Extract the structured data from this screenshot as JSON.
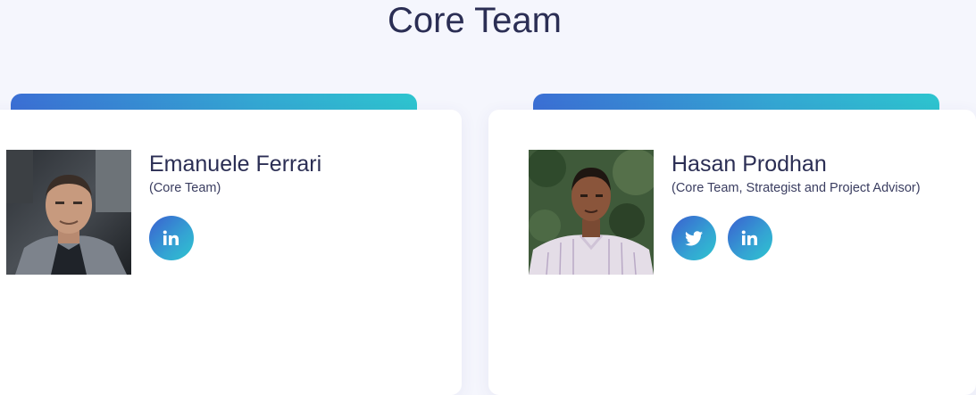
{
  "section": {
    "title": "Core Team"
  },
  "members": [
    {
      "name": "Emanuele Ferrari",
      "role": "(Core Team)",
      "photo_icon": "portrait-photo",
      "socials": [
        "linkedin-icon"
      ]
    },
    {
      "name": "Hasan Prodhan",
      "role": "(Core Team, Strategist and Project Advisor)",
      "photo_icon": "portrait-photo",
      "socials": [
        "twitter-icon",
        "linkedin-icon"
      ]
    }
  ],
  "colors": {
    "background": "#f5f6fd",
    "card": "#ffffff",
    "accent_start": "#3b6fd4",
    "accent_end": "#2ec4cf",
    "text": "#2b2e54"
  }
}
